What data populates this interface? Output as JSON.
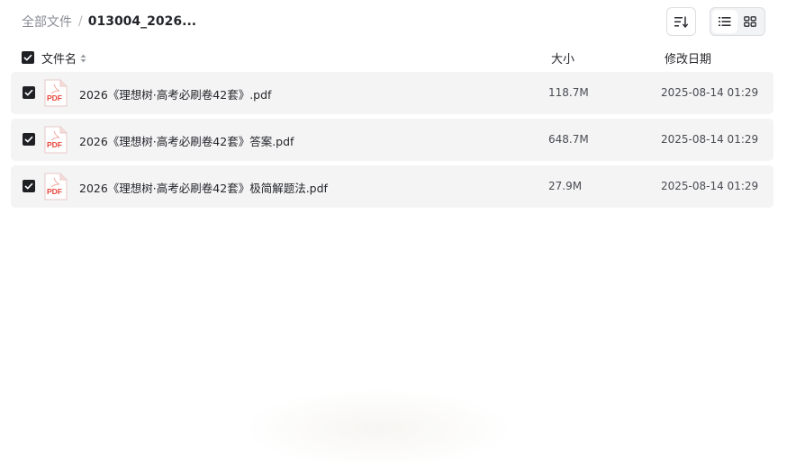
{
  "breadcrumb": {
    "root": "全部文件",
    "separator": "/",
    "current": "013004_2026..."
  },
  "toolbar": {
    "sort_icon": "sort-lines-icon",
    "view_modes": [
      {
        "name": "list",
        "icon": "list-icon",
        "active": true
      },
      {
        "name": "grid",
        "icon": "grid-icon",
        "active": false
      }
    ]
  },
  "table": {
    "columns": {
      "name": "文件名",
      "size": "大小",
      "modified": "修改日期"
    },
    "all_selected": true,
    "rows": [
      {
        "name": "2026《理想树·高考必刷卷42套》.pdf",
        "size": "118.7M",
        "modified": "2025-08-14 01:29",
        "selected": true,
        "type": "PDF"
      },
      {
        "name": "2026《理想树·高考必刷卷42套》答案.pdf",
        "size": "648.7M",
        "modified": "2025-08-14 01:29",
        "selected": true,
        "type": "PDF"
      },
      {
        "name": "2026《理想树·高考必刷卷42套》极简解题法.pdf",
        "size": "27.9M",
        "modified": "2025-08-14 01:29",
        "selected": true,
        "type": "PDF"
      }
    ]
  },
  "colors": {
    "pdf_red": "#e8443a",
    "row_bg": "#f4f4f5",
    "checkbox": "#1f2024"
  }
}
